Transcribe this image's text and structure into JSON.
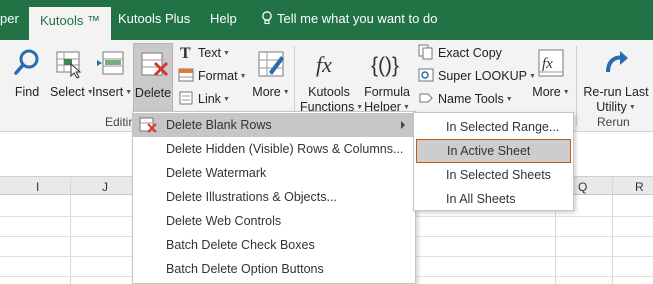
{
  "tabs": {
    "partial": "per",
    "kutools": "Kutools ™",
    "kutools_plus": "Kutools Plus",
    "help": "Help",
    "tell_me": "Tell me what you want to do"
  },
  "ribbon": {
    "find": "Find",
    "select": "Select",
    "insert": "Insert",
    "delete": "Delete",
    "text": "Text",
    "format": "Format",
    "link": "Link",
    "more1": "More",
    "kutools_functions_1": "Kutools",
    "kutools_functions_2": "Functions",
    "formula_helper_1": "Formula",
    "formula_helper_2": "Helper",
    "exact_copy": "Exact Copy",
    "super_lookup": "Super LOOKUP",
    "name_tools": "Name Tools",
    "more2": "More",
    "rerun_1": "Re-run Last",
    "rerun_2": "Utility",
    "group_editing": "Editin",
    "group_rerun": "Rerun"
  },
  "grid": {
    "columns": [
      "I",
      "J",
      "Q",
      "R"
    ]
  },
  "delete_menu": {
    "items": [
      "Delete Blank Rows",
      "Delete Hidden (Visible) Rows & Columns...",
      "Delete Watermark",
      "Delete Illustrations & Objects...",
      "Delete Web Controls",
      "Batch Delete Check Boxes",
      "Batch Delete Option Buttons"
    ]
  },
  "blank_rows_submenu": {
    "items": [
      "In Selected Range...",
      "In Active Sheet",
      "In Selected Sheets",
      "In All Sheets"
    ]
  },
  "colors": {
    "ribbon_tab_green": "#217346",
    "menu_highlight": "#c6c6c6",
    "selected_border": "#c55a11"
  }
}
